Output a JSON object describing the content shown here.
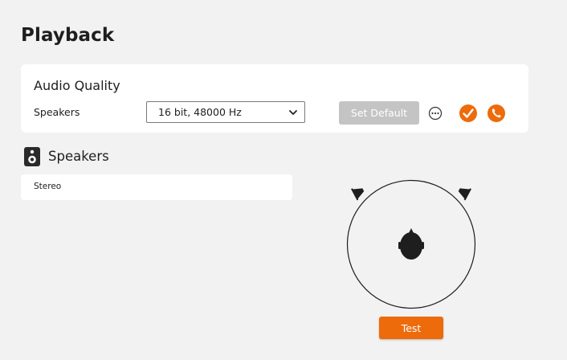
{
  "page": {
    "title": "Playback"
  },
  "audio_quality": {
    "title": "Audio Quality",
    "row_label": "Speakers",
    "format_select": {
      "value": "16 bit, 48000 Hz"
    },
    "set_default_label": "Set Default",
    "set_default_enabled": false,
    "icons": [
      "more-icon",
      "check-icon",
      "phone-icon"
    ]
  },
  "speakers_section": {
    "title": "Speakers",
    "icon": "speaker-icon",
    "configurations": [
      "Stereo"
    ]
  },
  "diagram": {
    "icons": [
      "left-speaker-icon",
      "right-speaker-icon",
      "listener-head-icon"
    ]
  },
  "test_button": {
    "label": "Test"
  },
  "colors": {
    "accent": "#ed6b0b",
    "background": "#f2f2f2",
    "card": "#ffffff",
    "disabled_button": "#c4c4c4"
  }
}
